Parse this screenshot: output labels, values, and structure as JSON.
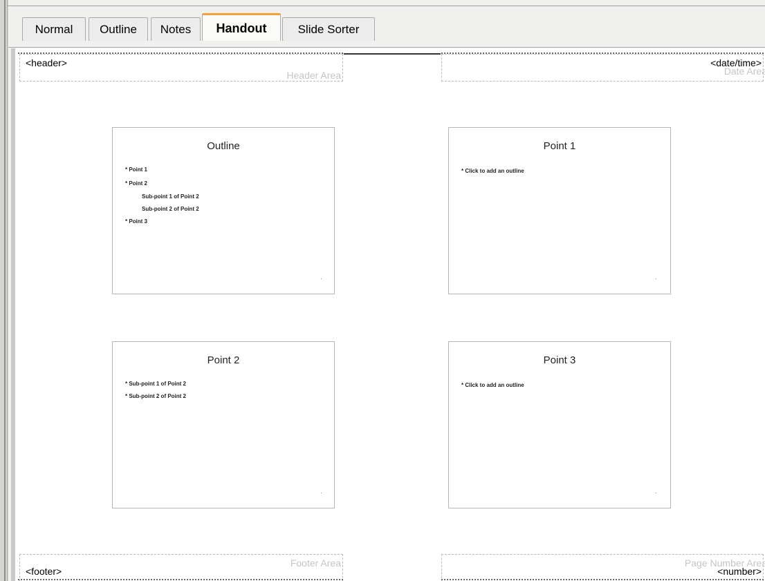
{
  "tabs": [
    {
      "label": "Normal"
    },
    {
      "label": "Outline"
    },
    {
      "label": "Notes"
    },
    {
      "label": "Handout"
    },
    {
      "label": "Slide Sorter"
    }
  ],
  "active_tab": "Handout",
  "page": {
    "header": {
      "placeholder": "<header>",
      "area_name": "Header Area"
    },
    "date": {
      "placeholder": "<date/time>",
      "area_name": "Date Area"
    },
    "footer": {
      "placeholder": "<footer>",
      "area_name": "Footer Area"
    },
    "page_number": {
      "placeholder": "<number>",
      "area_name": "Page Number Area"
    }
  },
  "slides": [
    {
      "title": "Outline",
      "bullets": [
        "* Point 1",
        "* Point 2"
      ],
      "sub_bullets": [
        "Sub-point 1 of Point 2",
        "Sub-point 2 of Point 2"
      ],
      "tail_bullets": [
        "* Point 3"
      ]
    },
    {
      "title": "Point 1",
      "bullets": [
        "* Click to add an outline"
      ]
    },
    {
      "title": "Point 2",
      "bullets": [
        "* Sub-point 1 of Point 2",
        "* Sub-point 2 of Point 2"
      ]
    },
    {
      "title": "Point 3",
      "bullets": [
        "* Click to add an outline"
      ]
    }
  ]
}
